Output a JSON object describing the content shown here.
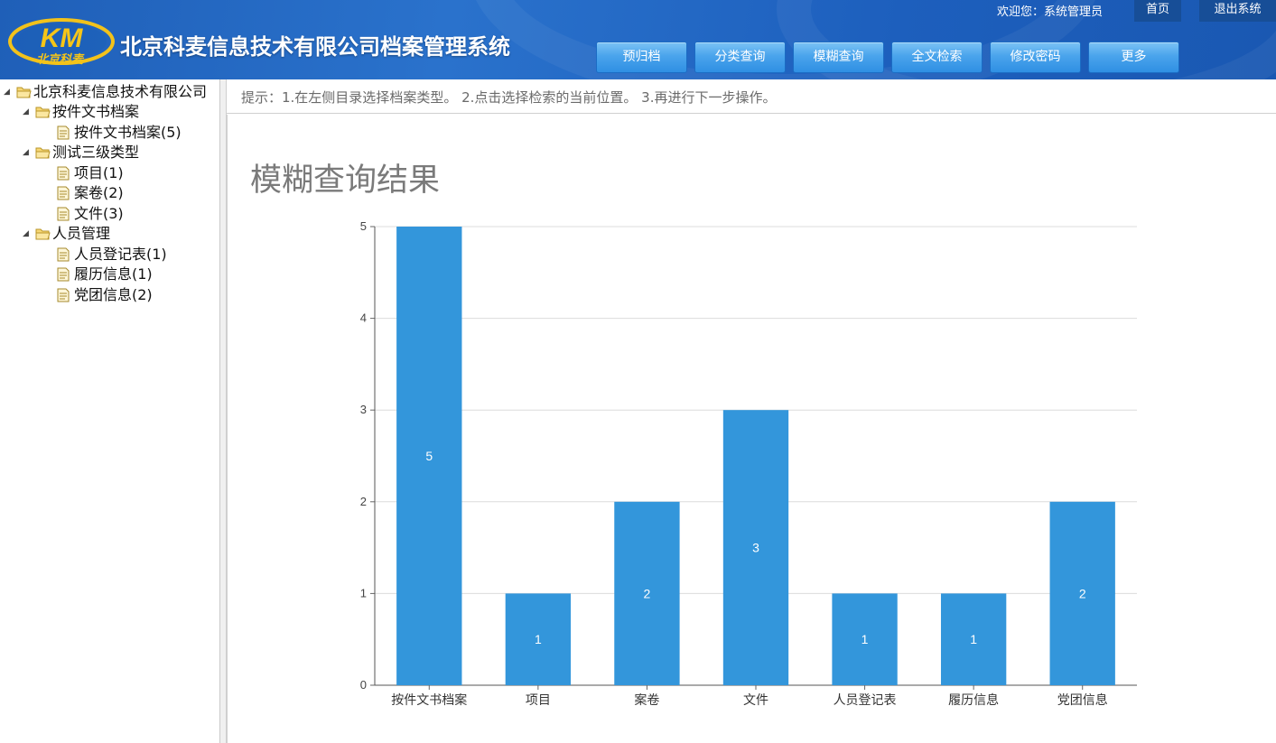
{
  "header": {
    "logo_text": "KM",
    "logo_subtext": "北京科麦",
    "title": "北京科麦信息技术有限公司档案管理系统",
    "welcome": "欢迎您：系统管理员",
    "home_label": "首页",
    "logout_label": "退出系统",
    "nav": [
      "预归档",
      "分类查询",
      "模糊查询",
      "全文检索",
      "修改密码",
      "更多"
    ],
    "colors": {
      "bar_bg": "#1f5fb8",
      "nav_btn": "#4aa4ec"
    }
  },
  "tree": {
    "root": "北京科麦信息技术有限公司",
    "groups": [
      {
        "label": "按件文书档案",
        "children": [
          "按件文书档案(5)"
        ]
      },
      {
        "label": "测试三级类型",
        "children": [
          "项目(1)",
          "案卷(2)",
          "文件(3)"
        ]
      },
      {
        "label": "人员管理",
        "children": [
          "人员登记表(1)",
          "履历信息(1)",
          "党团信息(2)"
        ]
      }
    ]
  },
  "hint": "提示：1.在左侧目录选择档案类型。 2.点击选择检索的当前位置。 3.再进行下一步操作。",
  "result_title": "模糊查询结果",
  "chart_data": {
    "type": "bar",
    "title": "",
    "xlabel": "",
    "ylabel": "",
    "categories": [
      "按件文书档案",
      "项目",
      "案卷",
      "文件",
      "人员登记表",
      "履历信息",
      "党团信息"
    ],
    "values": [
      5,
      1,
      2,
      3,
      1,
      1,
      2
    ],
    "ylim": [
      0,
      5
    ],
    "yticks": [
      0,
      1,
      2,
      3,
      4,
      5
    ],
    "grid": true,
    "bar_color": "#3396db",
    "label_color": "#ffffff"
  }
}
